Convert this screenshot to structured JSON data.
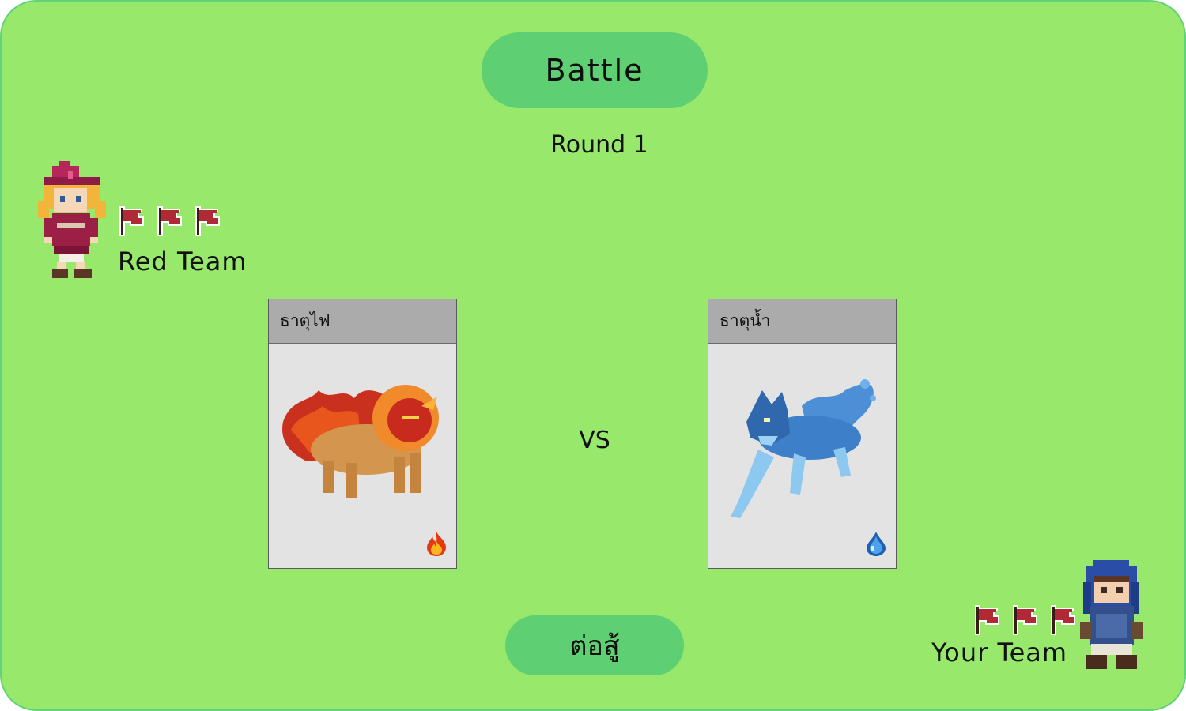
{
  "header": {
    "title": "Battle",
    "round_label": "Round 1"
  },
  "teams": {
    "red": {
      "name": "Red Team",
      "flags": 3
    },
    "yours": {
      "name": "Your Team",
      "flags": 3
    }
  },
  "vs_label": "VS",
  "cards": [
    {
      "name": "ธาตุไฟ",
      "element_icon": "fire-icon",
      "creature": "fire-lion"
    },
    {
      "name": "ธาตุน้ำ",
      "element_icon": "water-drop-icon",
      "creature": "water-wolf"
    }
  ],
  "actions": {
    "fight_label": "ต่อสู้"
  },
  "colors": {
    "background": "#97e86b",
    "pill": "#5fcf73",
    "card_header": "#ababab",
    "card_body": "#e3e3e3",
    "flag": "#b02a36"
  }
}
